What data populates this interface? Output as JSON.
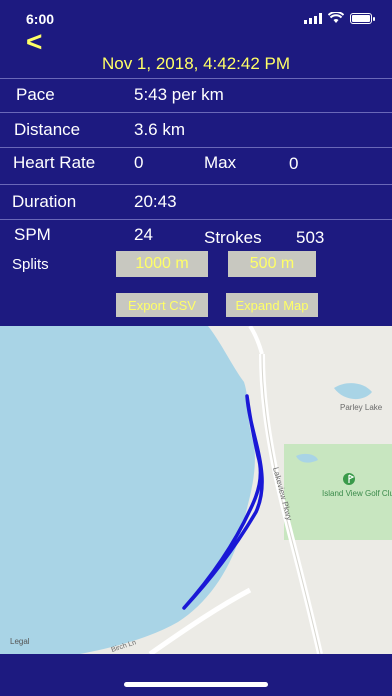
{
  "status": {
    "time": "6:00"
  },
  "nav": {
    "back_label": "<"
  },
  "header": {
    "date": "Nov 1, 2018, 4:42:42 PM"
  },
  "stats": {
    "pace_label": "Pace",
    "pace_value": "5:43 per km",
    "distance_label": "Distance",
    "distance_value": "3.6 km",
    "heart_rate_label": "Heart Rate",
    "heart_rate_value": "0",
    "max_label": "Max",
    "max_value": "0",
    "duration_label": "Duration",
    "duration_value": "20:43",
    "spm_label": "SPM",
    "spm_value": "24",
    "strokes_label": "Strokes",
    "strokes_value": "503"
  },
  "splits": {
    "label": "Splits",
    "options": [
      "1000 m",
      "500 m"
    ]
  },
  "actions": {
    "export_label": "Export CSV",
    "expand_label": "Expand Map"
  },
  "map": {
    "lake_name": "Parley Lake",
    "road_name": "Lakeview Pkwy",
    "golf_club": "Island View Golf Club",
    "bottom_road": "Birch Ln",
    "legal_label": "Legal",
    "route_color": "#1a18d6",
    "water_color": "#a9d4e6",
    "land_color": "#ecebe6",
    "park_color": "#c8e6c0"
  },
  "colors": {
    "background": "#1d1a80",
    "accent": "#ffff66",
    "button": "#c8c8c0"
  }
}
